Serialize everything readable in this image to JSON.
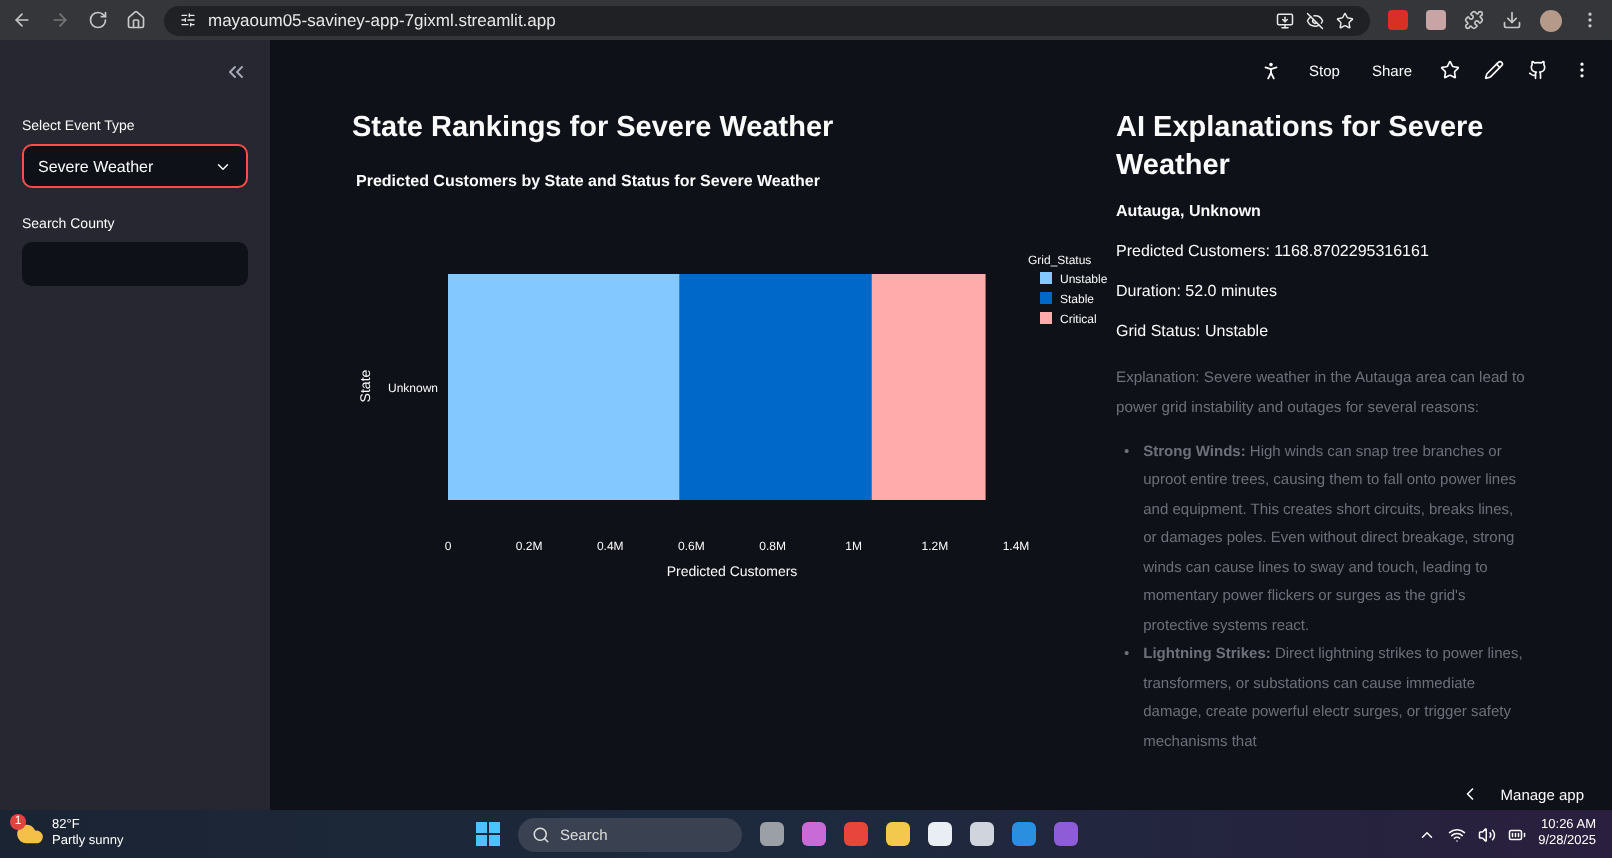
{
  "browser": {
    "url": "mayaoum05-saviney-app-7gixml.streamlit.app"
  },
  "header": {
    "buttons": [
      "Stop",
      "Share"
    ]
  },
  "sidebar": {
    "fields": [
      {
        "kind": "select",
        "label": "Select Event Type",
        "value": "Severe Weather",
        "focused": true
      },
      {
        "kind": "text",
        "label": "Search County",
        "focused": false
      }
    ]
  },
  "left": {
    "title": "State Rankings for Severe Weather",
    "chart_data": {
      "type": "bar",
      "orientation": "horizontal",
      "stacked": true,
      "title": "Predicted Customers by State and Status for Severe Weather",
      "xlabel": "Predicted Customers",
      "ylabel": "State",
      "categories": [
        "Unknown"
      ],
      "legend": {
        "title": "Grid_Status"
      },
      "series": [
        {
          "name": "Unstable",
          "color": "#83c9ff",
          "values": [
            571000
          ]
        },
        {
          "name": "Stable",
          "color": "#0068c9",
          "values": [
            473000
          ]
        },
        {
          "name": "Critical",
          "color": "#ffabab",
          "values": [
            281000
          ]
        }
      ],
      "xlim": [
        0,
        1400000
      ],
      "xticks": [
        {
          "value": 0,
          "label": "0"
        },
        {
          "value": 200000,
          "label": "0.2M"
        },
        {
          "value": 400000,
          "label": "0.4M"
        },
        {
          "value": 600000,
          "label": "0.6M"
        },
        {
          "value": 800000,
          "label": "0.8M"
        },
        {
          "value": 1000000,
          "label": "1M"
        },
        {
          "value": 1200000,
          "label": "1.2M"
        },
        {
          "value": 1400000,
          "label": "1.4M"
        }
      ]
    }
  },
  "right": {
    "title": "AI Explanations for Severe Weather",
    "facts": [
      {
        "text": "Autauga, Unknown",
        "bold": true
      },
      {
        "text": "Predicted Customers: 1168.8702295316161",
        "bold": false
      },
      {
        "text": "Duration: 52.0 minutes",
        "bold": false
      },
      {
        "text": "Grid Status: Unstable",
        "bold": false
      }
    ],
    "explanation": "Explanation: Severe weather in the Autauga area can lead to power grid instability and outages for several reasons:",
    "bullets": [
      {
        "marker": "•",
        "text": "**Strong Winds:** High winds can snap tree branches or uproot entire trees, causing them to fall onto power lines and equipment. This creates short circuits, breaks lines, or damages poles. Even without direct breakage, strong winds can cause lines to sway and touch, leading to momentary power flickers or surges as the grid's protective systems react."
      },
      {
        "marker": "•",
        "text": "**Lightning Strikes:** Direct lightning strikes to power lines, transformers, or substations can cause immediate damage, create powerful electr surges, or trigger safety mechanisms that"
      }
    ]
  },
  "manage_app": "Manage app",
  "taskbar": {
    "weather": {
      "badge": "1",
      "temp": "82°F",
      "condition": "Partly sunny"
    },
    "search_placeholder": "Search",
    "time": "10:26 AM",
    "date": "9/28/2025"
  }
}
